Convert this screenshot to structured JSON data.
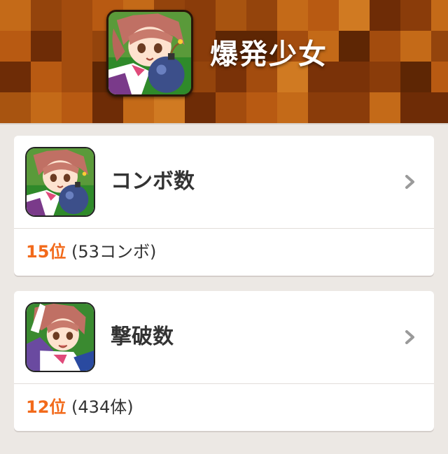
{
  "header": {
    "title": "爆発少女",
    "icon": "character-portrait-icon"
  },
  "cards": [
    {
      "label": "コンボ数",
      "rank": "15位",
      "detail": "(53コンボ)",
      "icon": "character-portrait-icon",
      "arrow": "chevron-right-icon"
    },
    {
      "label": "撃破数",
      "rank": "12位",
      "detail": "(434体)",
      "icon": "character-portrait-icon",
      "arrow": "chevron-right-icon"
    }
  ],
  "colors": {
    "accent": "#f26a1b",
    "header_bg": "#9a4a10",
    "page_bg": "#ece8e4",
    "text": "#333333"
  }
}
